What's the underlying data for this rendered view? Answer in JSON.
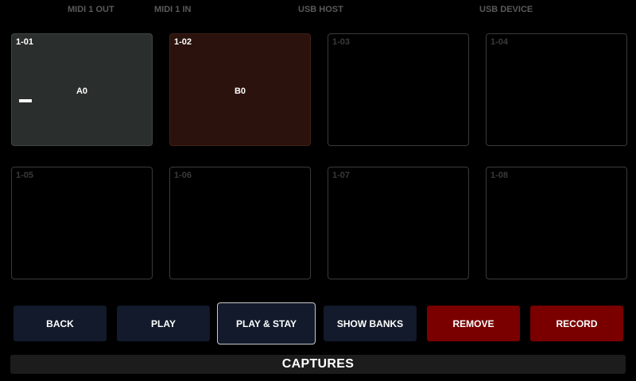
{
  "ports": {
    "midi1_out": "MIDI 1 OUT",
    "midi1_in": "MIDI 1 IN",
    "usb_host": "USB HOST",
    "usb_device": "USB DEVICE"
  },
  "pads": [
    {
      "id": "1-01",
      "note": "A0",
      "color": "#2a2f2d"
    },
    {
      "id": "1-02",
      "note": "B0",
      "color": "#2b120c"
    },
    {
      "id": "1-03",
      "note": ""
    },
    {
      "id": "1-04",
      "note": ""
    },
    {
      "id": "1-05",
      "note": ""
    },
    {
      "id": "1-06",
      "note": ""
    },
    {
      "id": "1-07",
      "note": ""
    },
    {
      "id": "1-08",
      "note": ""
    }
  ],
  "buttons": {
    "back": "BACK",
    "play": "PLAY",
    "play_stay": "PLAY & STAY",
    "show_banks": "SHOW BANKS",
    "remove": "REMOVE",
    "record": "RECORD"
  },
  "colors": {
    "button": "#121a2b",
    "danger": "#7a0000"
  },
  "status": {
    "title": "CAPTURES"
  }
}
